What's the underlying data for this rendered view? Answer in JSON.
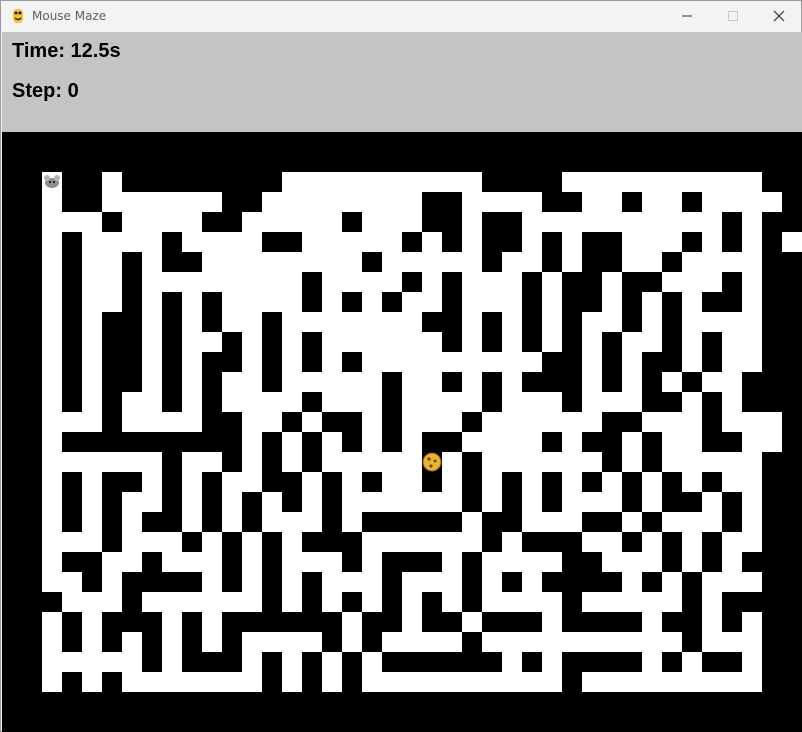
{
  "window": {
    "title": "Mouse Maze",
    "icon": "python-snake-icon",
    "controls": [
      "minimize-icon",
      "maximize-icon",
      "close-icon"
    ]
  },
  "hud": {
    "time_label": "Time:",
    "time_value": "12.5s",
    "step_label": "Step:",
    "step_value": "0",
    "background": "#c4c4c4"
  },
  "maze": {
    "columns": 39,
    "rows": 28,
    "wall_color": "#000000",
    "path_color": "#ffffff",
    "player": {
      "icon": "mouse-icon",
      "col": 1,
      "row": 1
    },
    "goal": {
      "icon": "cheese-icon",
      "col": 20,
      "row": 15
    },
    "grid": [
      "#######################################",
      "#.##.########..........####..........###",
      "#.##......##........##....##..#..#....##",
      "#...#....##.....#...##.##..........#.##",
      "#.#....#....##.....#.#.##.#.##...#.#.#.",
      "#.#..#.##........#.....#..#.##..#....#",
      "#.#..#........#....#.#...#.##.##...#.#",
      "#.#..#.#.#....#.#.#..#...#.##.#.#.##.#",
      "#.#.##.#.#..#.......##.#.#.#..#.#....#",
      "#.#.##.#..#.#.#......#.#.#.#.#..#.#..#",
      "#.#.##.#.##.#.#.#.........##.#.##.#..#",
      "#.#.##.#.#..#.....#..#.#.###.#.#.#..##",
      "#.#.#..#.#....#...#....#...#...##.#.##",
      "#...#....##..#.##.#...#......##...#...#",
      "#.#########.#.#.#.#.##....#.##.#..##..#",
      "#......#..#.#.#.....#.#......#.#.....#",
      "#.#.##.#.#..##.#.#..#.#.#.#.#.#.#.#..#",
      "#.#.#..#.#.#.#.#......#.#.#...#.##.#.#",
      "#.#.#.##.#.#...#.#####.##...##.#...#.#",
      "#...#...#.#.#.###......#.###..#.#.#..#",
      "#.##..#...#.#...#.###.#....##...#.#.##",
      "#..#.####.#.#.#...#...#.#.####.#.#...#",
      "##...#......#.#.#.#.#.#....#.....#.###",
      "#.#.###.#.######.##.##.###.####.##.#.#",
      "#.#.#.#.#.#....#.#....#..........#...#",
      "#.....#.###.#.#.#.######.#.####.#.##.#",
      "#.#.#.......#.#.#..........#.........#",
      "#######################################"
    ]
  }
}
